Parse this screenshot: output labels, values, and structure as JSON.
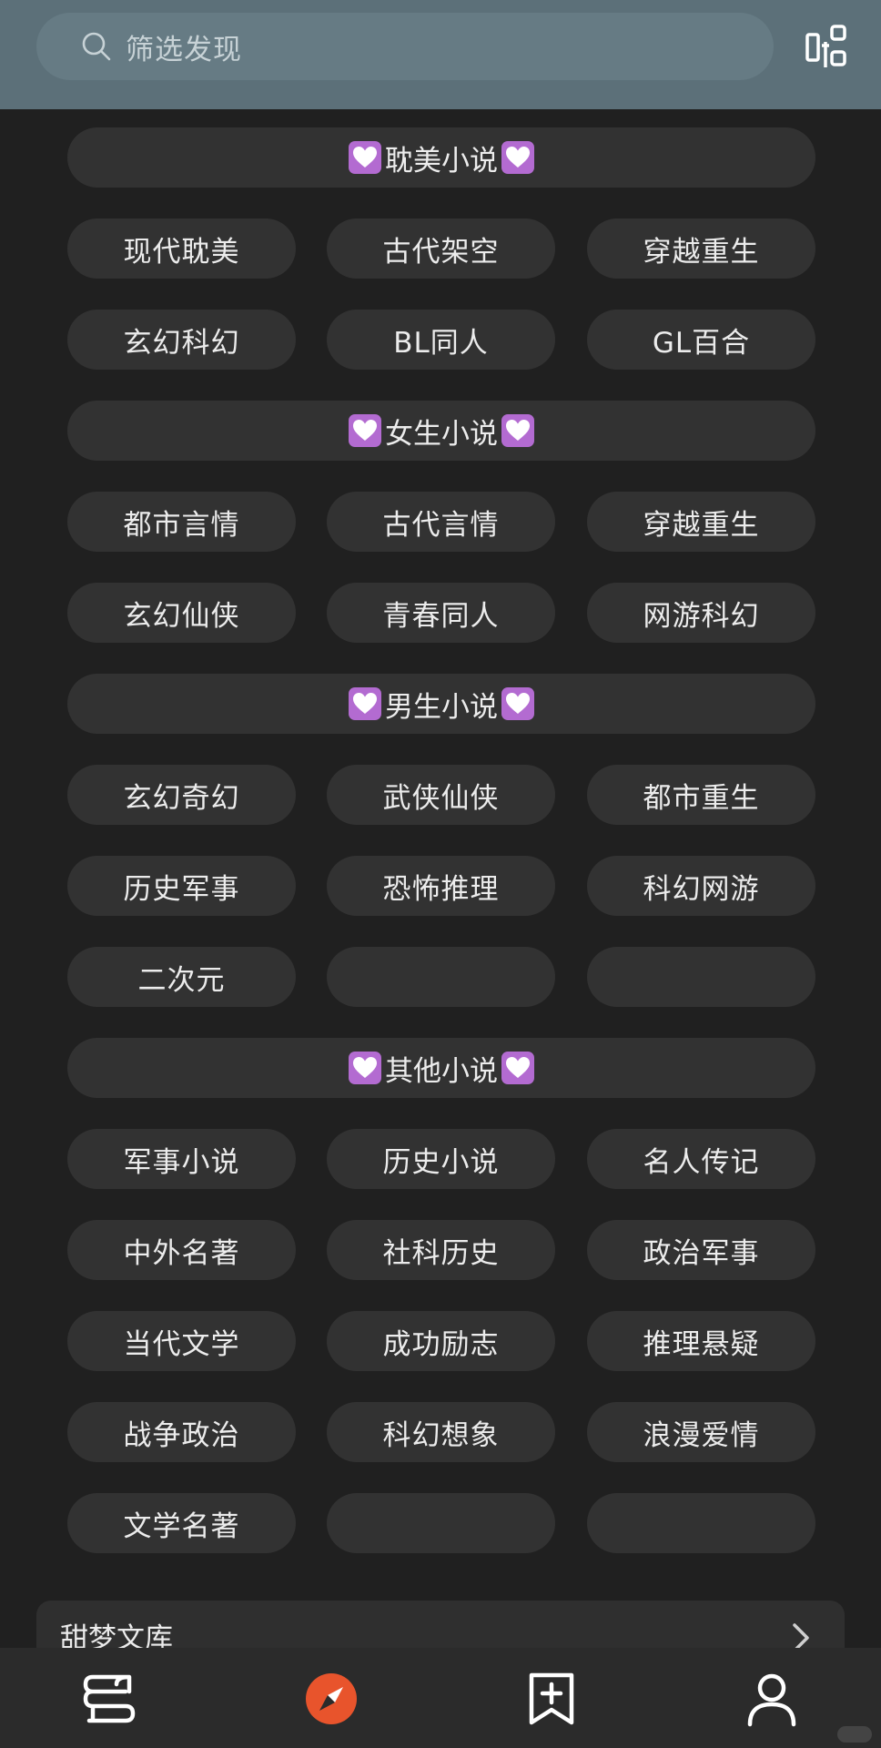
{
  "search": {
    "placeholder": "筛选发现"
  },
  "sections": [
    {
      "title": "耽美小说",
      "items": [
        "现代耽美",
        "古代架空",
        "穿越重生",
        "玄幻科幻",
        "BL同人",
        "GL百合"
      ]
    },
    {
      "title": "女生小说",
      "items": [
        "都市言情",
        "古代言情",
        "穿越重生",
        "玄幻仙侠",
        "青春同人",
        "网游科幻"
      ]
    },
    {
      "title": "男生小说",
      "items": [
        "玄幻奇幻",
        "武侠仙侠",
        "都市重生",
        "历史军事",
        "恐怖推理",
        "科幻网游",
        "二次元",
        "",
        ""
      ]
    },
    {
      "title": "其他小说",
      "items": [
        "军事小说",
        "历史小说",
        "名人传记",
        "中外名著",
        "社科历史",
        "政治军事",
        "当代文学",
        "成功励志",
        "推理悬疑",
        "战争政治",
        "科幻想象",
        "浪漫爱情",
        "文学名著",
        "",
        ""
      ]
    }
  ],
  "library": {
    "title": "甜梦文库"
  },
  "colors": {
    "topbar": "#5c7079",
    "background": "#202020",
    "pill": "#323232",
    "heart_bg": "#b36bd1",
    "accent": "#e8542c"
  },
  "icons": {
    "search": "search-icon",
    "scan": "scan-icon",
    "heart": "heart-icon",
    "chevron": "chevron-right-icon",
    "nav": [
      "bookshelf-icon",
      "compass-icon",
      "bookmark-add-icon",
      "user-icon"
    ]
  }
}
